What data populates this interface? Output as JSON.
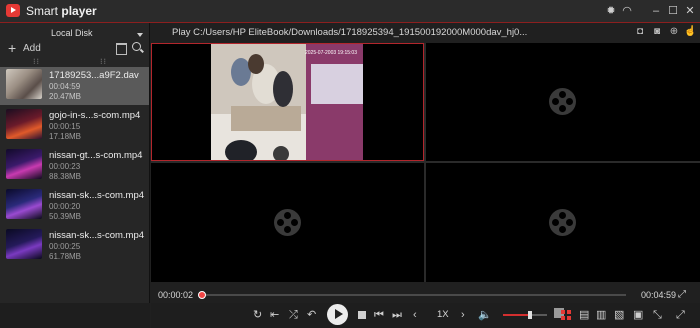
{
  "app": {
    "title_plain": "Smart",
    "title_bold": "player"
  },
  "titlebar_icons": [
    "gear-icon",
    "headset-icon",
    "minimize-icon",
    "maximize-icon",
    "close-icon"
  ],
  "sidebar": {
    "location": "Local Disk",
    "add_label": "Add",
    "files": [
      {
        "name": "17189253...a9F2.dav",
        "duration": "00:04:59",
        "size": "20.47MB",
        "selected": true
      },
      {
        "name": "gojo-in-s...s-com.mp4",
        "duration": "00:00:15",
        "size": "17.18MB",
        "selected": false
      },
      {
        "name": "nissan-gt...s-com.mp4",
        "duration": "00:00:23",
        "size": "88.38MB",
        "selected": false
      },
      {
        "name": "nissan-sk...s-com.mp4",
        "duration": "00:00:20",
        "size": "50.39MB",
        "selected": false
      },
      {
        "name": "nissan-sk...s-com.mp4",
        "duration": "00:00:25",
        "size": "61.78MB",
        "selected": false
      }
    ]
  },
  "path": {
    "text": "Play  C:/Users/HP EliteBook/Downloads/1718925394_191500192000M000dav_hj0..."
  },
  "video": {
    "overlay_time": "2025-07-2003 19:15:03"
  },
  "timeline": {
    "current": "00:00:02",
    "total": "00:04:59",
    "progress": 0.0067
  },
  "controls": {
    "speed": "1X",
    "volume": 0.62
  },
  "colors": {
    "accent": "#d32f2f",
    "active_border": "#b3262c",
    "selected_row": "#5a5a5a"
  }
}
